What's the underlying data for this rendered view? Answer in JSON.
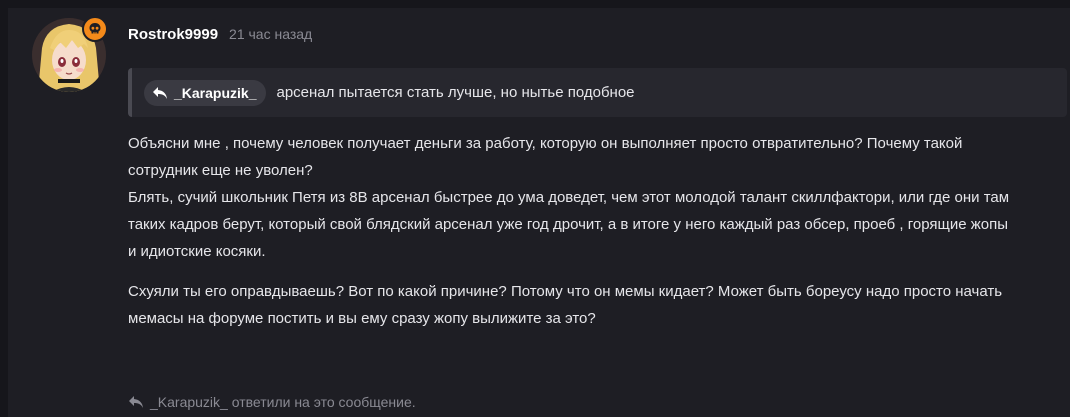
{
  "post": {
    "author": "Rostrok9999",
    "time": "21 час назад",
    "avatar_badge_icon": "skull-icon",
    "quote": {
      "icon": "reply-arrow-icon",
      "user": "_Karapuzik_",
      "text": "арсенал пытается стать лучше, но нытье подобное"
    },
    "body": {
      "line1": "Объясни мне , почему человек получает деньги за работу, которую он выполняет просто отвратительно? Почему такой",
      "line2": "сотрудник еще не уволен?",
      "line3": "Блять, сучий школьник Петя из 8В арсенал быстрее до ума доведет, чем этот молодой талант скиллфактори, или где они там",
      "line4": "таких кадров берут, который свой блядский арсенал уже год дрочит, а в итоге у него каждый раз обсер, проеб , горящие жопы",
      "line5": "и идиотские косяки.",
      "line6": "Схуяли ты его оправдываешь? Вот по какой причине? Потому что он мемы кидает? Может быть бореусу надо просто начать",
      "line7": "мемасы на форуме постить и вы ему сразу жопу вылижите за это?"
    },
    "reply_note": {
      "icon": "reply-arrow-icon",
      "user": "_Karapuzik_",
      "text": "ответили на это сообщение."
    }
  },
  "colors": {
    "background": "#1e1e24",
    "quote_background": "#27272e",
    "badge": "#f48a1a",
    "muted_text": "#8a8a93"
  }
}
